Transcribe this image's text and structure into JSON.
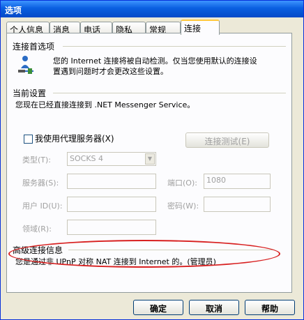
{
  "window": {
    "title": "选项"
  },
  "tabs": [
    {
      "label": "个人信息"
    },
    {
      "label": "消息"
    },
    {
      "label": "电话"
    },
    {
      "label": "隐私"
    },
    {
      "label": "常规"
    },
    {
      "label": "连接"
    }
  ],
  "connection_pref": {
    "title": "连接首选项",
    "description_line1": "您的 Internet 连接将被自动检测。仅当您使用默认的连接设",
    "description_line2": "置遇到问题时才会更改这些设置。"
  },
  "current_settings": {
    "title": "当前设置",
    "status": "您现在已经直接连接到 .NET Messenger Service。"
  },
  "proxy": {
    "checkbox_label": "我使用代理服务器(X)",
    "test_button": "连接测试(E)",
    "type_label": "类型(T):",
    "type_value": "SOCKS 4",
    "server_label": "服务器(S):",
    "port_label": "端口(O):",
    "port_value": "1080",
    "userid_label": "用户 ID(U):",
    "password_label": "密码(W):",
    "domain_label": "领域(R):"
  },
  "advanced": {
    "title": "高级连接信息",
    "status": "您是通过非 UPnP 对称 NAT 连接到 Internet 的。(管理员)"
  },
  "footer": {
    "ok": "确定",
    "cancel": "取消",
    "help": "帮助"
  }
}
